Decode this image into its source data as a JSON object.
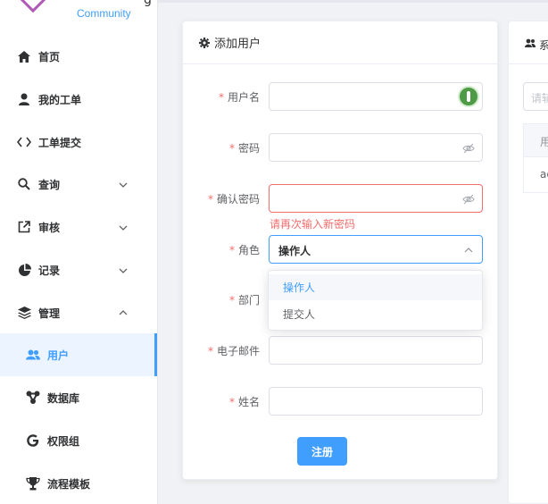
{
  "logo": {
    "text": "Community",
    "partial_letter": "g"
  },
  "sidebar": {
    "items": [
      {
        "label": "首页",
        "icon": "home-icon"
      },
      {
        "label": "我的工单",
        "icon": "user-icon"
      },
      {
        "label": "工单提交",
        "icon": "code-icon"
      },
      {
        "label": "查询",
        "icon": "search-icon",
        "expandable": true,
        "expanded": false
      },
      {
        "label": "审核",
        "icon": "external-link-icon",
        "expandable": true,
        "expanded": false
      },
      {
        "label": "记录",
        "icon": "pie-chart-icon",
        "expandable": true,
        "expanded": false
      },
      {
        "label": "管理",
        "icon": "layers-icon",
        "expandable": true,
        "expanded": true
      }
    ],
    "subitems": [
      {
        "label": "用户",
        "icon": "users-icon",
        "active": true
      },
      {
        "label": "数据库",
        "icon": "database-icon",
        "active": false
      },
      {
        "label": "权限组",
        "icon": "google-icon",
        "active": false
      },
      {
        "label": "流程模板",
        "icon": "trophy-icon",
        "active": false
      }
    ]
  },
  "form": {
    "title": "添加用户",
    "title_icon": "gear-icon",
    "fields": {
      "username": {
        "label": "用户名",
        "value": "",
        "required": true
      },
      "password": {
        "label": "密码",
        "value": "",
        "required": true
      },
      "confirm": {
        "label": "确认密码",
        "value": "",
        "required": true,
        "error": "请再次输入新密码"
      },
      "role": {
        "label": "角色",
        "value": "操作人",
        "required": true,
        "options": [
          "操作人",
          "提交人"
        ]
      },
      "department": {
        "label": "部门",
        "value": "",
        "required": true
      },
      "email": {
        "label": "电子邮件",
        "value": "",
        "required": true
      },
      "name": {
        "label": "姓名",
        "value": "",
        "required": true
      }
    },
    "submit_label": "注册"
  },
  "right_panel": {
    "title_partial": "系",
    "search_placeholder_partial": "请辅",
    "header_partial": "用",
    "row_partial": "ac"
  },
  "colors": {
    "primary": "#409eff",
    "danger": "#f56c6c",
    "logo": "#b05ab6"
  }
}
